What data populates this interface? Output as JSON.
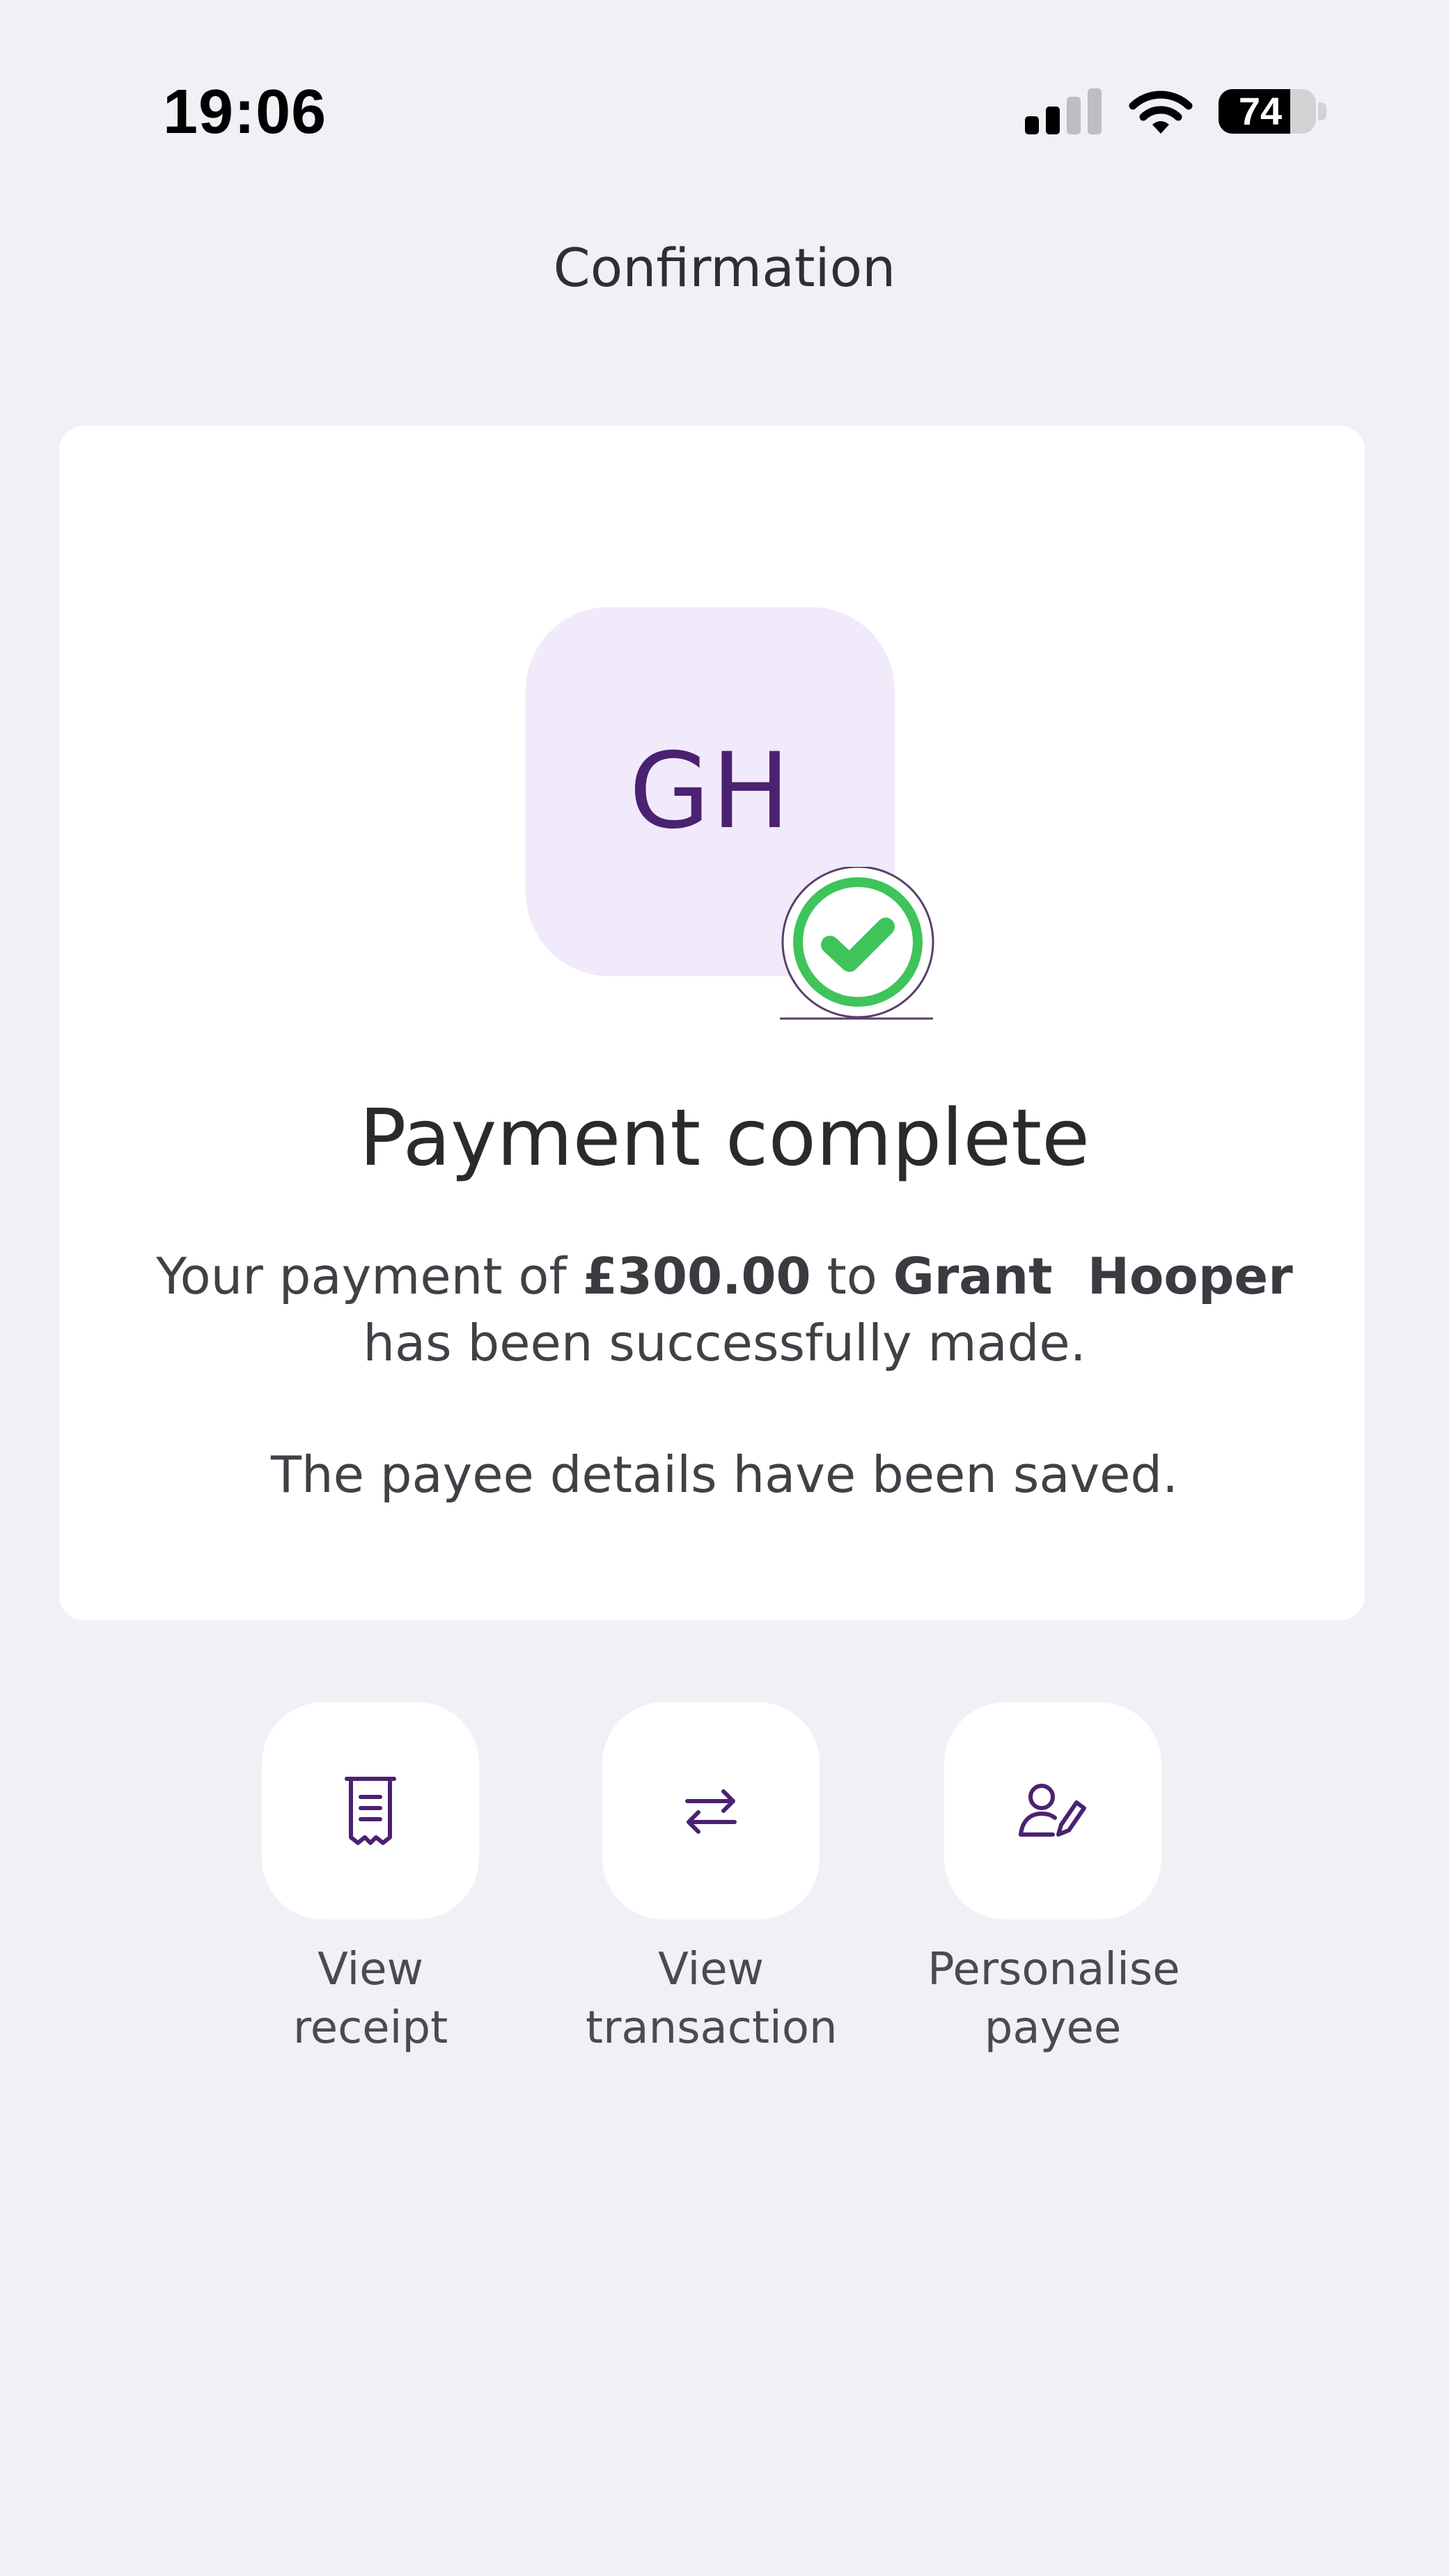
{
  "status_bar": {
    "time": "19:06",
    "battery_percent": "74",
    "signal_bars_active": 2,
    "signal_bars_total": 4
  },
  "header": {
    "title": "Confirmation"
  },
  "confirmation": {
    "initials": "GH",
    "heading": "Payment complete",
    "message_prefix": "Your payment of ",
    "amount": "£300.00",
    "message_mid": " to ",
    "payee_name": "Grant  Hooper",
    "message_suffix": " has been successfully made.",
    "saved_note": "The payee details have been saved."
  },
  "actions": [
    {
      "label": "View\nreceipt",
      "icon": "receipt-icon"
    },
    {
      "label": "View\ntransaction",
      "icon": "transfer-arrows-icon"
    },
    {
      "label": "Personalise\npayee",
      "icon": "edit-person-icon"
    }
  ],
  "colors": {
    "accent": "#4b2171",
    "success": "#3ec45a",
    "background": "#f1f0f7",
    "avatar_bg": "#f0eafa"
  }
}
